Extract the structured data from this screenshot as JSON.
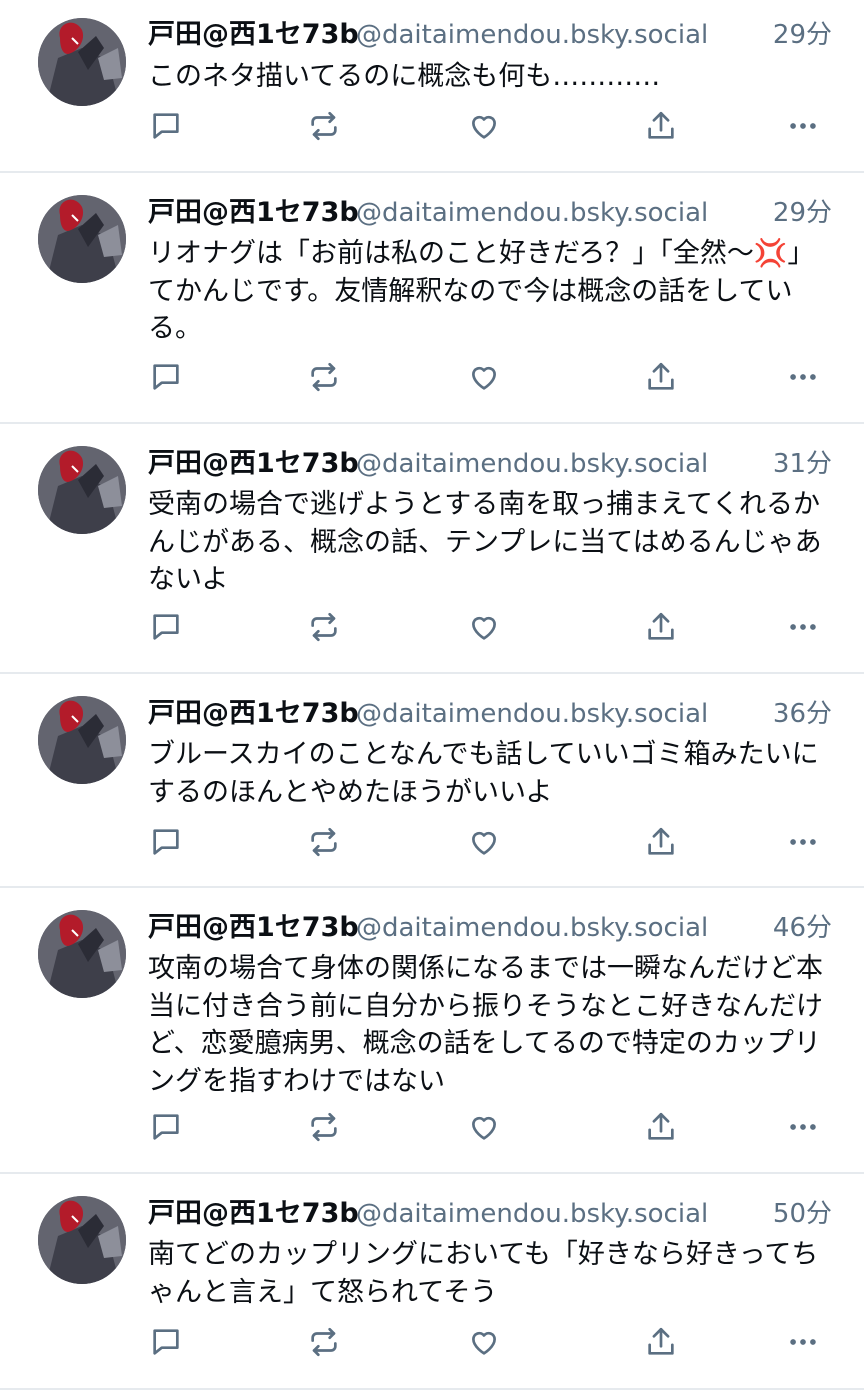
{
  "author": {
    "display_name": "戸田@西1セ73b",
    "handle": "@daitaimendou.bsky.social",
    "avatar_icon": "avatar-image"
  },
  "icons": {
    "reply": "comment-icon",
    "repost": "repost-icon",
    "like": "heart-icon",
    "share": "share-icon",
    "more": "more-dots-icon"
  },
  "colors": {
    "text": "#0b0f14",
    "muted": "#5b6f82",
    "icon": "#5b6f82",
    "divider": "#e6eaee"
  },
  "posts": [
    {
      "time": "29分",
      "text": "このネタ描いてるのに概念も何も…………"
    },
    {
      "time": "29分",
      "text": "リオナグは「お前は私のこと好きだろ？」「全然〜💢」\nてかんじです。友情解釈なので今は概念の話をしている。"
    },
    {
      "time": "31分",
      "text": "受南の場合で逃げようとする南を取っ捕まえてくれるかんじがある、概念の話、テンプレに当てはめるんじゃあないよ"
    },
    {
      "time": "36分",
      "text": "ブルースカイのことなんでも話していいゴミ箱みたいにするのほんとやめたほうがいいよ"
    },
    {
      "time": "46分",
      "text": "攻南の場合て身体の関係になるまでは一瞬なんだけど本当に付き合う前に自分から振りそうなとこ好きなんだけど、恋愛臆病男、概念の話をしてるので特定のカップリングを指すわけではない"
    },
    {
      "time": "50分",
      "text": "南てどのカップリングにおいても「好きなら好きってちゃんと言え」て怒られてそう"
    }
  ]
}
